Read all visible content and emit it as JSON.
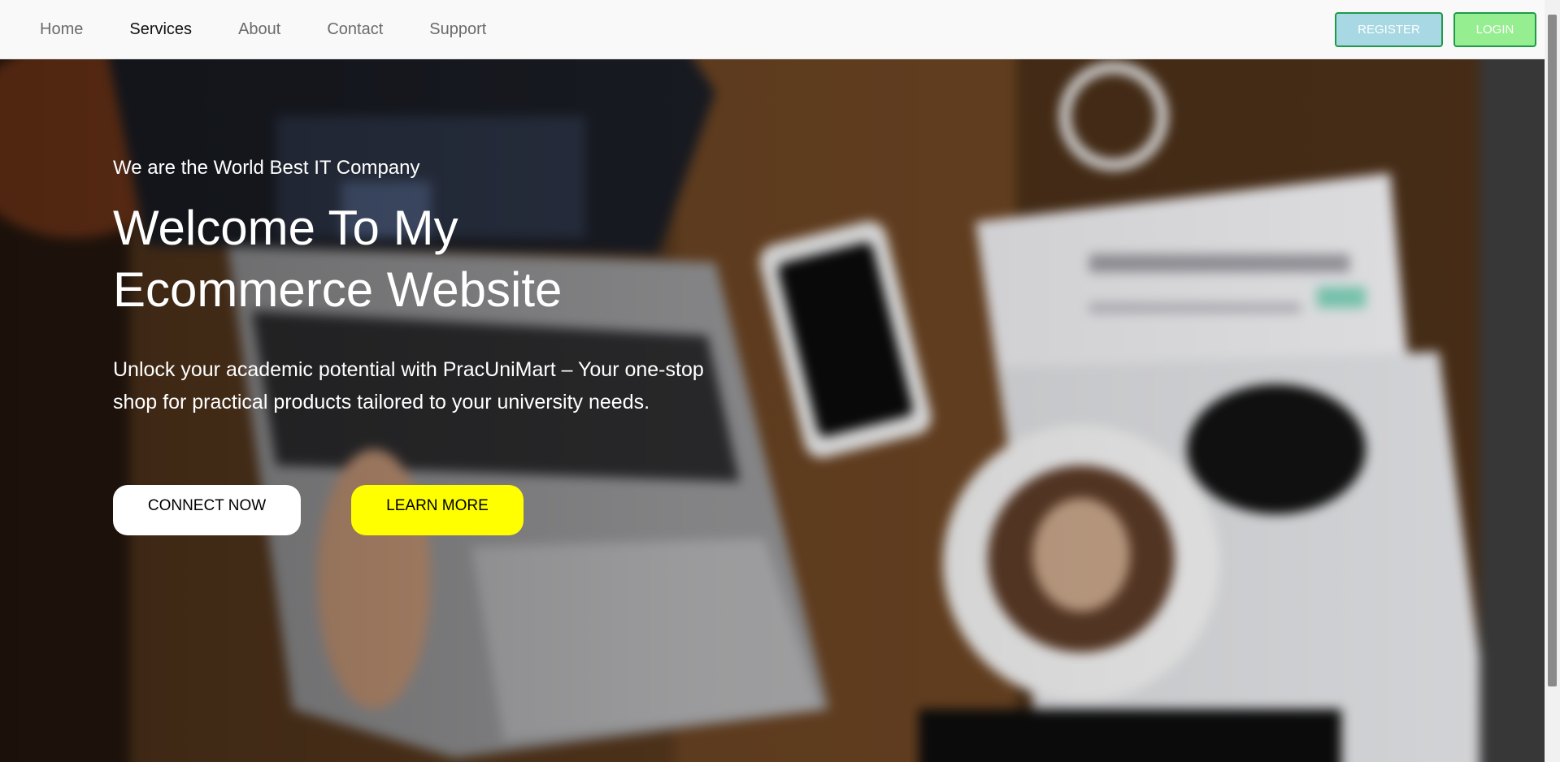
{
  "nav": {
    "links": [
      {
        "label": "Home",
        "active": false
      },
      {
        "label": "Services",
        "active": true
      },
      {
        "label": "About",
        "active": false
      },
      {
        "label": "Contact",
        "active": false
      },
      {
        "label": "Support",
        "active": false
      }
    ],
    "register_label": "REGISTER",
    "login_label": "LOGIN"
  },
  "hero": {
    "tagline": "We are the World Best IT Company",
    "title_line1": "Welcome To My",
    "title_line2": "Ecommerce Website",
    "description": "Unlock your academic potential with PracUniMart – Your one-stop shop for practical products tailored to your university needs.",
    "connect_label": "CONNECT NOW",
    "learn_label": "LEARN MORE"
  },
  "colors": {
    "register_bg": "#a7d8e3",
    "login_bg": "#95ee8f",
    "auth_border": "#1f9a4b",
    "learn_bg": "#ffff00",
    "connect_bg": "#ffffff"
  }
}
